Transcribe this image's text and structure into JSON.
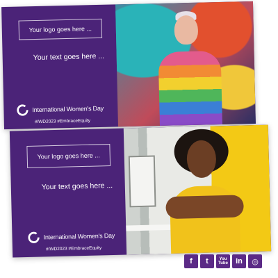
{
  "cards": [
    {
      "logo_placeholder": "Your logo goes here ...",
      "text_placeholder": "Your text goes here ...",
      "brand_name": "International Women's Day",
      "hashtags": "#IWD2023 #EmbraceEquity"
    },
    {
      "logo_placeholder": "Your logo goes here ...",
      "text_placeholder": "Your text goes here ...",
      "brand_name": "International Women's Day",
      "hashtags": "#IWD2023 #EmbraceEquity"
    }
  ],
  "social_icons": [
    {
      "name": "facebook-icon",
      "glyph": "f"
    },
    {
      "name": "twitter-icon",
      "glyph": "t"
    },
    {
      "name": "youtube-icon",
      "glyph": "You Tube"
    },
    {
      "name": "linkedin-icon",
      "glyph": "in"
    },
    {
      "name": "instagram-icon",
      "glyph": "◎"
    }
  ],
  "colors": {
    "brand_purple": "#4b2378",
    "social_purple": "#5b2a86"
  }
}
